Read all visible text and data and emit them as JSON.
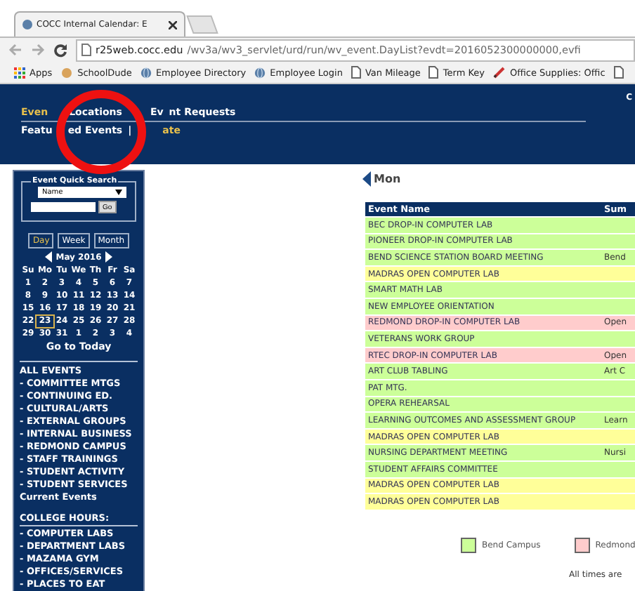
{
  "browser": {
    "tab_title": "COCC Internal Calendar: E",
    "url_host": "r25web.cocc.edu",
    "url_path": "/wv3a/wv3_servlet/urd/run/wv_event.DayList?evdt=2016052300000000,evfi",
    "bookmarks": [
      {
        "kind": "apps",
        "label": "Apps"
      },
      {
        "kind": "cookie",
        "label": "SchoolDude"
      },
      {
        "kind": "globe",
        "label": "Employee Directory"
      },
      {
        "kind": "globe",
        "label": "Employee Login"
      },
      {
        "kind": "page",
        "label": "Van Mileage"
      },
      {
        "kind": "page",
        "label": "Term Key"
      },
      {
        "kind": "pencil",
        "label": "Office Supplies: Offic"
      },
      {
        "kind": "page"
      }
    ]
  },
  "header": {
    "corner_text": "C",
    "nav": [
      {
        "parts": [
          "Even"
        ],
        "selected": true
      },
      {
        "parts": [
          "Locations"
        ],
        "selected": false
      },
      {
        "parts": [
          "Ev",
          "nt Requests"
        ],
        "selected": false
      }
    ],
    "subnav_separator": "|",
    "subnav": [
      {
        "parts": [
          "Featu",
          "ed Events"
        ],
        "selected": false
      },
      {
        "parts": [
          "ate"
        ],
        "selected": true
      }
    ]
  },
  "sidebar": {
    "quick_search": {
      "title": "Event Quick Search",
      "select_value": "Name",
      "button": "Go"
    },
    "view_buttons": [
      {
        "label": "Day",
        "selected": true
      },
      {
        "label": "Week",
        "selected": false
      },
      {
        "label": "Month",
        "selected": false
      }
    ],
    "month": "May 2016",
    "weekdays": [
      "Su",
      "Mo",
      "Tu",
      "We",
      "Th",
      "Fr",
      "Sa"
    ],
    "weeks": [
      [
        {
          "day": "1",
          "selected": false
        },
        {
          "day": "2",
          "selected": false
        },
        {
          "day": "3",
          "selected": false
        },
        {
          "day": "4",
          "selected": false
        },
        {
          "day": "5",
          "selected": false
        },
        {
          "day": "6",
          "selected": false
        },
        {
          "day": "7",
          "selected": false
        }
      ],
      [
        {
          "day": "8",
          "selected": false
        },
        {
          "day": "9",
          "selected": false
        },
        {
          "day": "10",
          "selected": false
        },
        {
          "day": "11",
          "selected": false
        },
        {
          "day": "12",
          "selected": false
        },
        {
          "day": "13",
          "selected": false
        },
        {
          "day": "14",
          "selected": false
        }
      ],
      [
        {
          "day": "15",
          "selected": false
        },
        {
          "day": "16",
          "selected": false
        },
        {
          "day": "17",
          "selected": false
        },
        {
          "day": "18",
          "selected": false
        },
        {
          "day": "19",
          "selected": false
        },
        {
          "day": "20",
          "selected": false
        },
        {
          "day": "21",
          "selected": false
        }
      ],
      [
        {
          "day": "22",
          "selected": false
        },
        {
          "day": "23",
          "selected": true
        },
        {
          "day": "24",
          "selected": false
        },
        {
          "day": "25",
          "selected": false
        },
        {
          "day": "26",
          "selected": false
        },
        {
          "day": "27",
          "selected": false
        },
        {
          "day": "28",
          "selected": false
        }
      ],
      [
        {
          "day": "29",
          "selected": false
        },
        {
          "day": "30",
          "selected": false
        },
        {
          "day": "31",
          "selected": false
        },
        {
          "day": "1",
          "selected": false
        },
        {
          "day": "2",
          "selected": false
        },
        {
          "day": "3",
          "selected": false
        },
        {
          "day": "4",
          "selected": false
        }
      ]
    ],
    "today_link": "Go to Today",
    "event_links": [
      "ALL EVENTS",
      "- COMMITTEE MTGS",
      "- CONTINUING ED.",
      "- CULTURAL/ARTS",
      "- EXTERNAL GROUPS",
      "- INTERNAL BUSINESS",
      "- REDMOND CAMPUS",
      "- STAFF TRAININGS",
      "- STUDENT ACTIVITY",
      "- STUDENT SERVICES",
      "Current Events"
    ],
    "hours_title": "COLLEGE HOURS:",
    "hours_links": [
      "- COMPUTER LABS",
      "- DEPARTMENT LABS",
      "- MAZAMA GYM",
      "- OFFICES/SERVICES",
      "- PLACES TO EAT"
    ]
  },
  "content": {
    "day_nav": "Mon",
    "table": {
      "columns": [
        "Event Name",
        "Sum"
      ],
      "rows": [
        {
          "name": "BEC DROP-IN COMPUTER LAB",
          "color": "#ccff99"
        },
        {
          "name": "PIONEER DROP-IN COMPUTER LAB",
          "color": "#ccff99"
        },
        {
          "name": "BEND SCIENCE STATION BOARD MEETING",
          "column_2": "Bend",
          "color": "#ccff99"
        },
        {
          "name": "MADRAS OPEN COMPUTER LAB",
          "color": "#ffff99"
        },
        {
          "name": "SMART MATH LAB",
          "color": "#ccff99"
        },
        {
          "name": "NEW EMPLOYEE ORIENTATION",
          "color": "#ccff99"
        },
        {
          "name": "REDMOND DROP-IN COMPUTER LAB",
          "column_2": "Open",
          "color": "#ffcccc"
        },
        {
          "name": "VETERANS WORK GROUP",
          "color": "#ccff99"
        },
        {
          "name": "RTEC DROP-IN COMPUTER LAB",
          "column_2": "Open",
          "color": "#ffcccc"
        },
        {
          "name": "ART CLUB TABLING",
          "column_2": "Art C",
          "color": "#ccff99"
        },
        {
          "name": "PAT MTG.",
          "color": "#ccff99"
        },
        {
          "name": "OPERA REHEARSAL",
          "color": "#ccff99"
        },
        {
          "name": "LEARNING OUTCOMES AND ASSESSMENT GROUP",
          "column_2": "Learn",
          "color": "#ccff99"
        },
        {
          "name": "MADRAS OPEN COMPUTER LAB",
          "color": "#ffff99"
        },
        {
          "name": "NURSING DEPARTMENT MEETING",
          "column_2": "Nursi",
          "color": "#ccff99"
        },
        {
          "name": "STUDENT AFFAIRS COMMITTEE",
          "color": "#ccff99"
        },
        {
          "name": "MADRAS OPEN COMPUTER LAB",
          "color": "#ffff99"
        },
        {
          "name": "MADRAS OPEN COMPUTER LAB",
          "color": "#ffff99"
        }
      ]
    },
    "legend": [
      {
        "label": "Bend Campus",
        "color": "#ccff99"
      },
      {
        "label": "Redmond",
        "color": "#ffcccc"
      }
    ],
    "footer": "All times are"
  }
}
